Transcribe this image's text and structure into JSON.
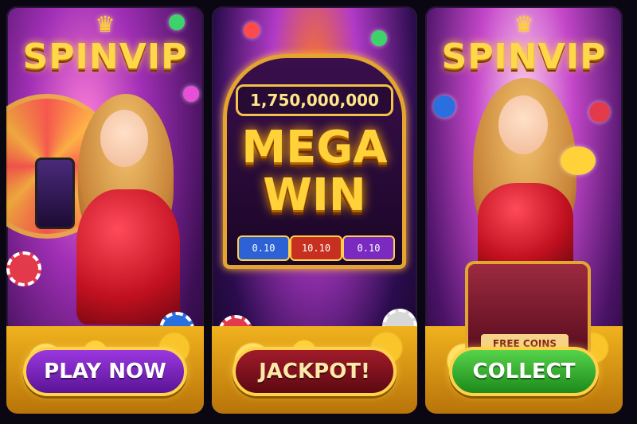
{
  "panels": [
    {
      "logo": "SPINVIP",
      "button": "PLAY NOW"
    },
    {
      "jackpot_amount": "1,750,000,000",
      "headline_line1": "MEGA",
      "headline_line2": "WIN",
      "reels": [
        "0.10",
        "10.10",
        "0.10"
      ],
      "button": "JACKPOT!"
    },
    {
      "logo": "SPINVIP",
      "chest_label": "FREE COINS",
      "button": "COLLECT"
    }
  ],
  "colors": {
    "gold": "#ffd23a",
    "purple": "#7b2bc0",
    "red": "#a11b2a",
    "green": "#3cb53a"
  }
}
